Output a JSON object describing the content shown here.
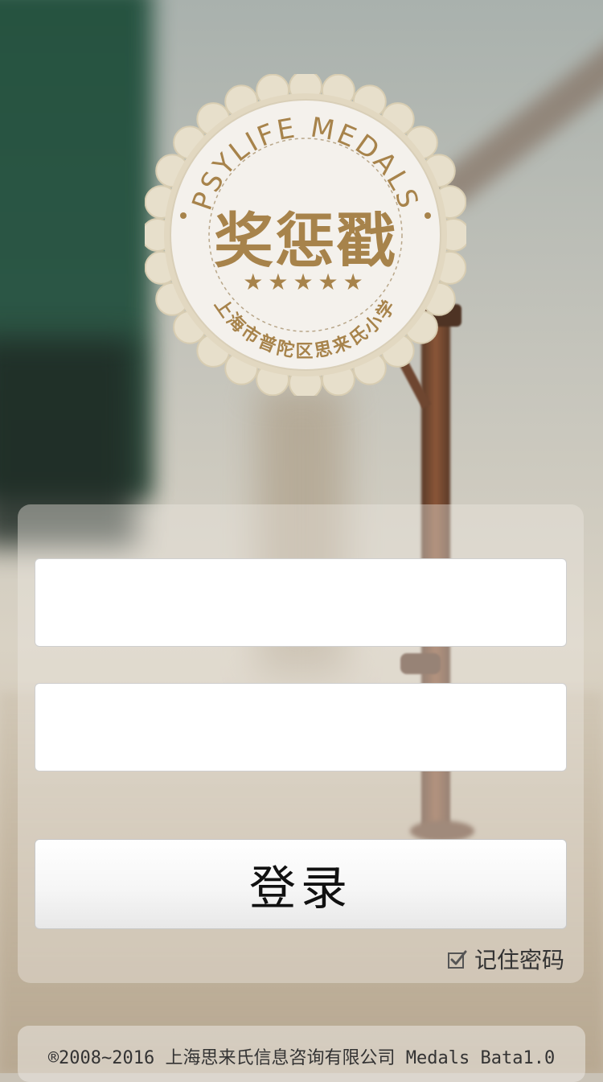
{
  "medal": {
    "arc_top_text": "PSYLIFE MEDALS",
    "title_cn": "奖惩戳",
    "stars": "★★★★★",
    "arc_bottom_text": "上海市普陀区思来氏小学",
    "colors": {
      "gold": "#a7834b",
      "face": "#f3f0ea",
      "rim": "#e3dac6"
    }
  },
  "login": {
    "username_value": "",
    "username_placeholder": "",
    "password_value": "",
    "password_placeholder": "",
    "submit_label": "登录",
    "remember_label": "记住密码",
    "remember_checked": true
  },
  "footer": {
    "text": "®2008~2016 上海思来氏信息咨询有限公司 Medals Bata1.0"
  }
}
